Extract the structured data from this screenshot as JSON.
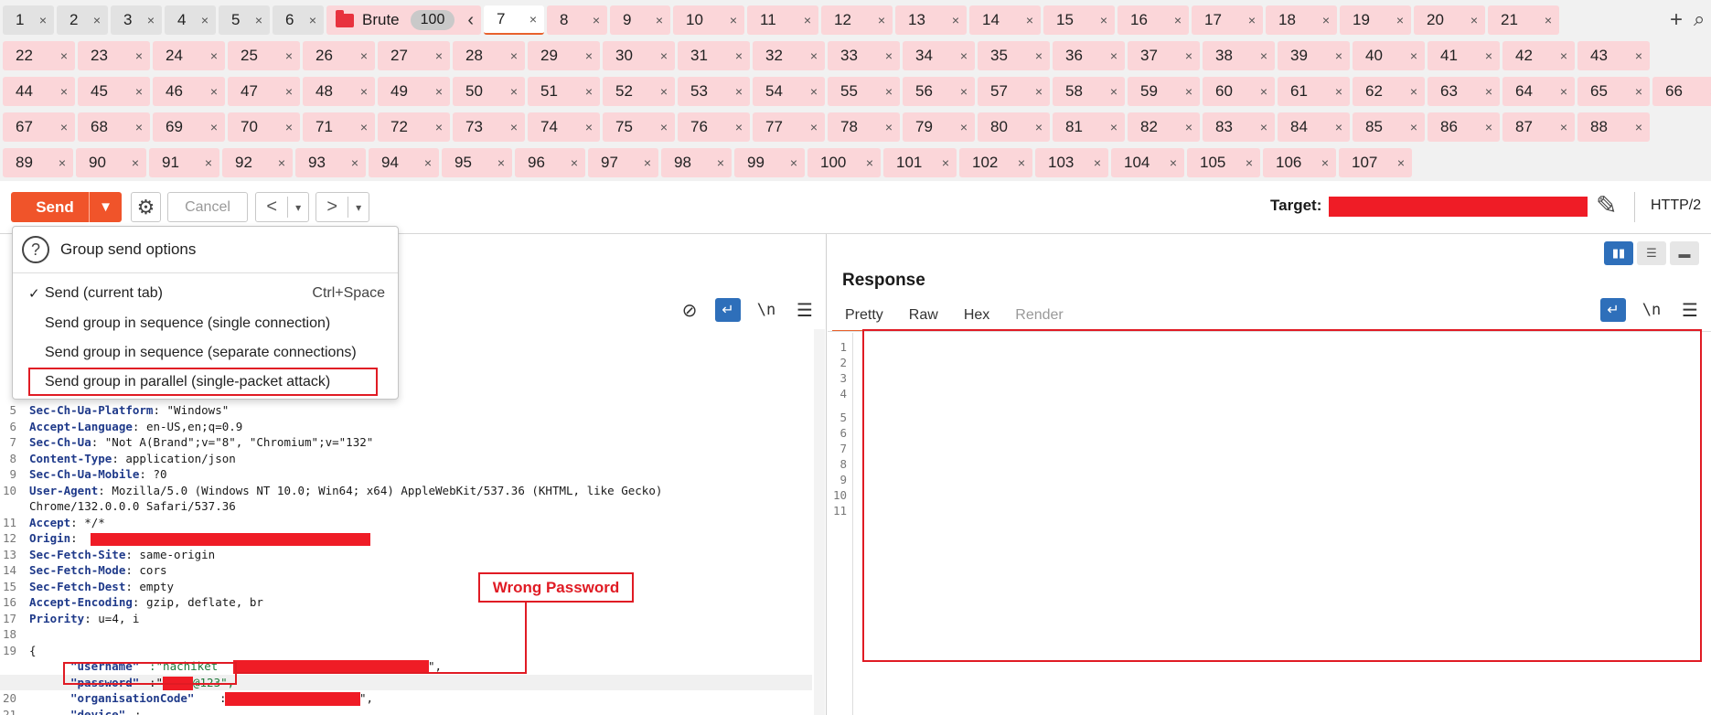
{
  "tabbar": {
    "gray_tabs": [
      "1",
      "2",
      "3",
      "4",
      "5",
      "6"
    ],
    "group": {
      "name": "Brute",
      "count": "100",
      "collapse_icon": "chevron-left"
    },
    "row1": [
      "7",
      "8",
      "9",
      "10",
      "11",
      "12",
      "13",
      "14",
      "15",
      "16",
      "17",
      "18",
      "19",
      "20",
      "21"
    ],
    "row2": [
      "22",
      "23",
      "24",
      "25",
      "26",
      "27",
      "28",
      "29",
      "30",
      "31",
      "32",
      "33",
      "34",
      "35",
      "36",
      "37",
      "38",
      "39",
      "40",
      "41",
      "42",
      "43"
    ],
    "row3": [
      "44",
      "45",
      "46",
      "47",
      "48",
      "49",
      "50",
      "51",
      "52",
      "53",
      "54",
      "55",
      "56",
      "57",
      "58",
      "59",
      "60",
      "61",
      "62",
      "63",
      "64",
      "65",
      "66"
    ],
    "row4": [
      "67",
      "68",
      "69",
      "70",
      "71",
      "72",
      "73",
      "74",
      "75",
      "76",
      "77",
      "78",
      "79",
      "80",
      "81",
      "82",
      "83",
      "84",
      "85",
      "86",
      "87",
      "88"
    ],
    "row5": [
      "89",
      "90",
      "91",
      "92",
      "93",
      "94",
      "95",
      "96",
      "97",
      "98",
      "99",
      "100",
      "101",
      "102",
      "103",
      "104",
      "105",
      "106",
      "107"
    ],
    "active_tab": "7",
    "close_glyph": "×",
    "add_icon": "+",
    "search_icon": "⌕",
    "colors": {
      "grouped_tab": "#fbd6d9",
      "plain_tab": "#e2e2e2",
      "accent": "#e8612c"
    }
  },
  "toolbar": {
    "send_label": "Send",
    "cancel_label": "Cancel",
    "back_glyph": "<",
    "forward_glyph": ">",
    "dropdown_glyph": "▾",
    "target_label": "Target:",
    "protocol": "HTTP/2",
    "send_color": "#f0542a"
  },
  "send_menu": {
    "header": "Group send options",
    "items": [
      {
        "label": "Send (current tab)",
        "shortcut": "Ctrl+Space",
        "checked": "✓"
      },
      {
        "label": "Send group in sequence (single connection)"
      },
      {
        "label": "Send group in sequence (separate connections)"
      },
      {
        "label": "Send group in parallel (single-packet attack)"
      }
    ]
  },
  "request": {
    "lines": [
      {
        "n": "5",
        "key": "Sec-Ch-Ua-Platform",
        "val": ": \"Windows\""
      },
      {
        "n": "6",
        "key": "Accept-Language",
        "val": ": en-US,en;q=0.9"
      },
      {
        "n": "7",
        "key": "Sec-Ch-Ua",
        "val": ": \"Not A(Brand\";v=\"8\", \"Chromium\";v=\"132\""
      },
      {
        "n": "8",
        "key": "Content-Type",
        "val": ": application/json"
      },
      {
        "n": "9",
        "key": "Sec-Ch-Ua-Mobile",
        "val": ": ?0"
      },
      {
        "n": "10",
        "key": "User-Agent",
        "val": ": Mozilla/5.0 (Windows NT 10.0; Win64; x64) AppleWebKit/537.36 (KHTML, like Gecko)"
      },
      {
        "n": "",
        "key": "",
        "val": "Chrome/132.0.0.0 Safari/537.36"
      },
      {
        "n": "11",
        "key": "Accept",
        "val": ": */*"
      },
      {
        "n": "12",
        "key": "Origin",
        "val": ":"
      },
      {
        "n": "13",
        "key": "Sec-Fetch-Site",
        "val": ": same-origin"
      },
      {
        "n": "14",
        "key": "Sec-Fetch-Mode",
        "val": ": cors"
      },
      {
        "n": "15",
        "key": "Sec-Fetch-Dest",
        "val": ": empty"
      },
      {
        "n": "16",
        "key": "Accept-Encoding",
        "val": ": gzip, deflate, br"
      },
      {
        "n": "17",
        "key": "Priority",
        "val": ": u=4, i"
      },
      {
        "n": "18",
        "key": "",
        "val": ""
      },
      {
        "n": "19",
        "key": "",
        "val": "{"
      }
    ],
    "body": {
      "username_key": "\"username\"",
      "username_val": ":\"nachiket",
      "username_tail": "\",",
      "password_key": "\"password\"",
      "password_prefix": ":\"",
      "password_val": "@123\",",
      "org_n": "20",
      "org_key": "\"organisationCode\"",
      "org_sep": ":",
      "org_tail": "\",",
      "device_n": "21",
      "device_key": "\"device\"",
      "device_sep": ":"
    },
    "icons": {
      "hide": "⊘",
      "wrap": "↵",
      "newline": "\\n",
      "menu": "☰"
    }
  },
  "response": {
    "title": "Response",
    "tabs": [
      "Pretty",
      "Raw",
      "Hex",
      "Render"
    ],
    "line_numbers": [
      "1",
      "2",
      "3",
      "4",
      "5",
      "6",
      "7",
      "8",
      "9",
      "10",
      "11"
    ],
    "layout_icons": [
      "▮▮",
      "☰",
      "▬"
    ]
  },
  "annotation": {
    "label": "Wrong Password",
    "color": "#e01b24"
  }
}
